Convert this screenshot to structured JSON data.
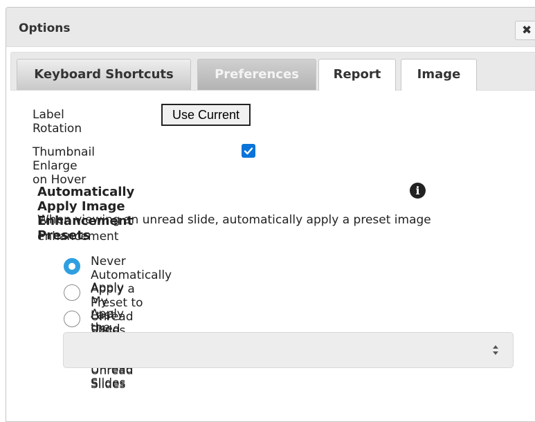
{
  "dialog": {
    "title": "Options",
    "close_glyph": "✖"
  },
  "tabs": [
    {
      "label": "Keyboard Shortcuts",
      "state": "inactive"
    },
    {
      "label": "Preferences",
      "state": "active"
    },
    {
      "label": "Report",
      "state": "inactive"
    },
    {
      "label": "Image",
      "state": "inactive"
    }
  ],
  "preferences": {
    "label_rotation": {
      "label": "Label Rotation",
      "button_label": "Use Current"
    },
    "thumbnail_enlarge": {
      "label": "Thumbnail Enlarge on Hover",
      "checked": true
    },
    "auto_apply": {
      "title": "Automatically Apply Image Enhancement Presets",
      "info_glyph": "i",
      "description": "When viewing an unread slide, automatically apply a preset image enhancement",
      "options": [
        {
          "label": "Never Automatically Apply a Preset to Unread Slides",
          "selected": true
        },
        {
          "label": "Apply My Last Used Preset to Unread Slides",
          "selected": false
        },
        {
          "label": "Apply the Following Preset to Unread Slides",
          "selected": false
        }
      ],
      "preset_select_value": ""
    }
  },
  "colors": {
    "accent": "#2f9fe0",
    "checkbox": "#0a74d9"
  },
  "icons": [
    "close-icon",
    "info-icon",
    "checkmark-icon",
    "select-arrows-icon"
  ]
}
